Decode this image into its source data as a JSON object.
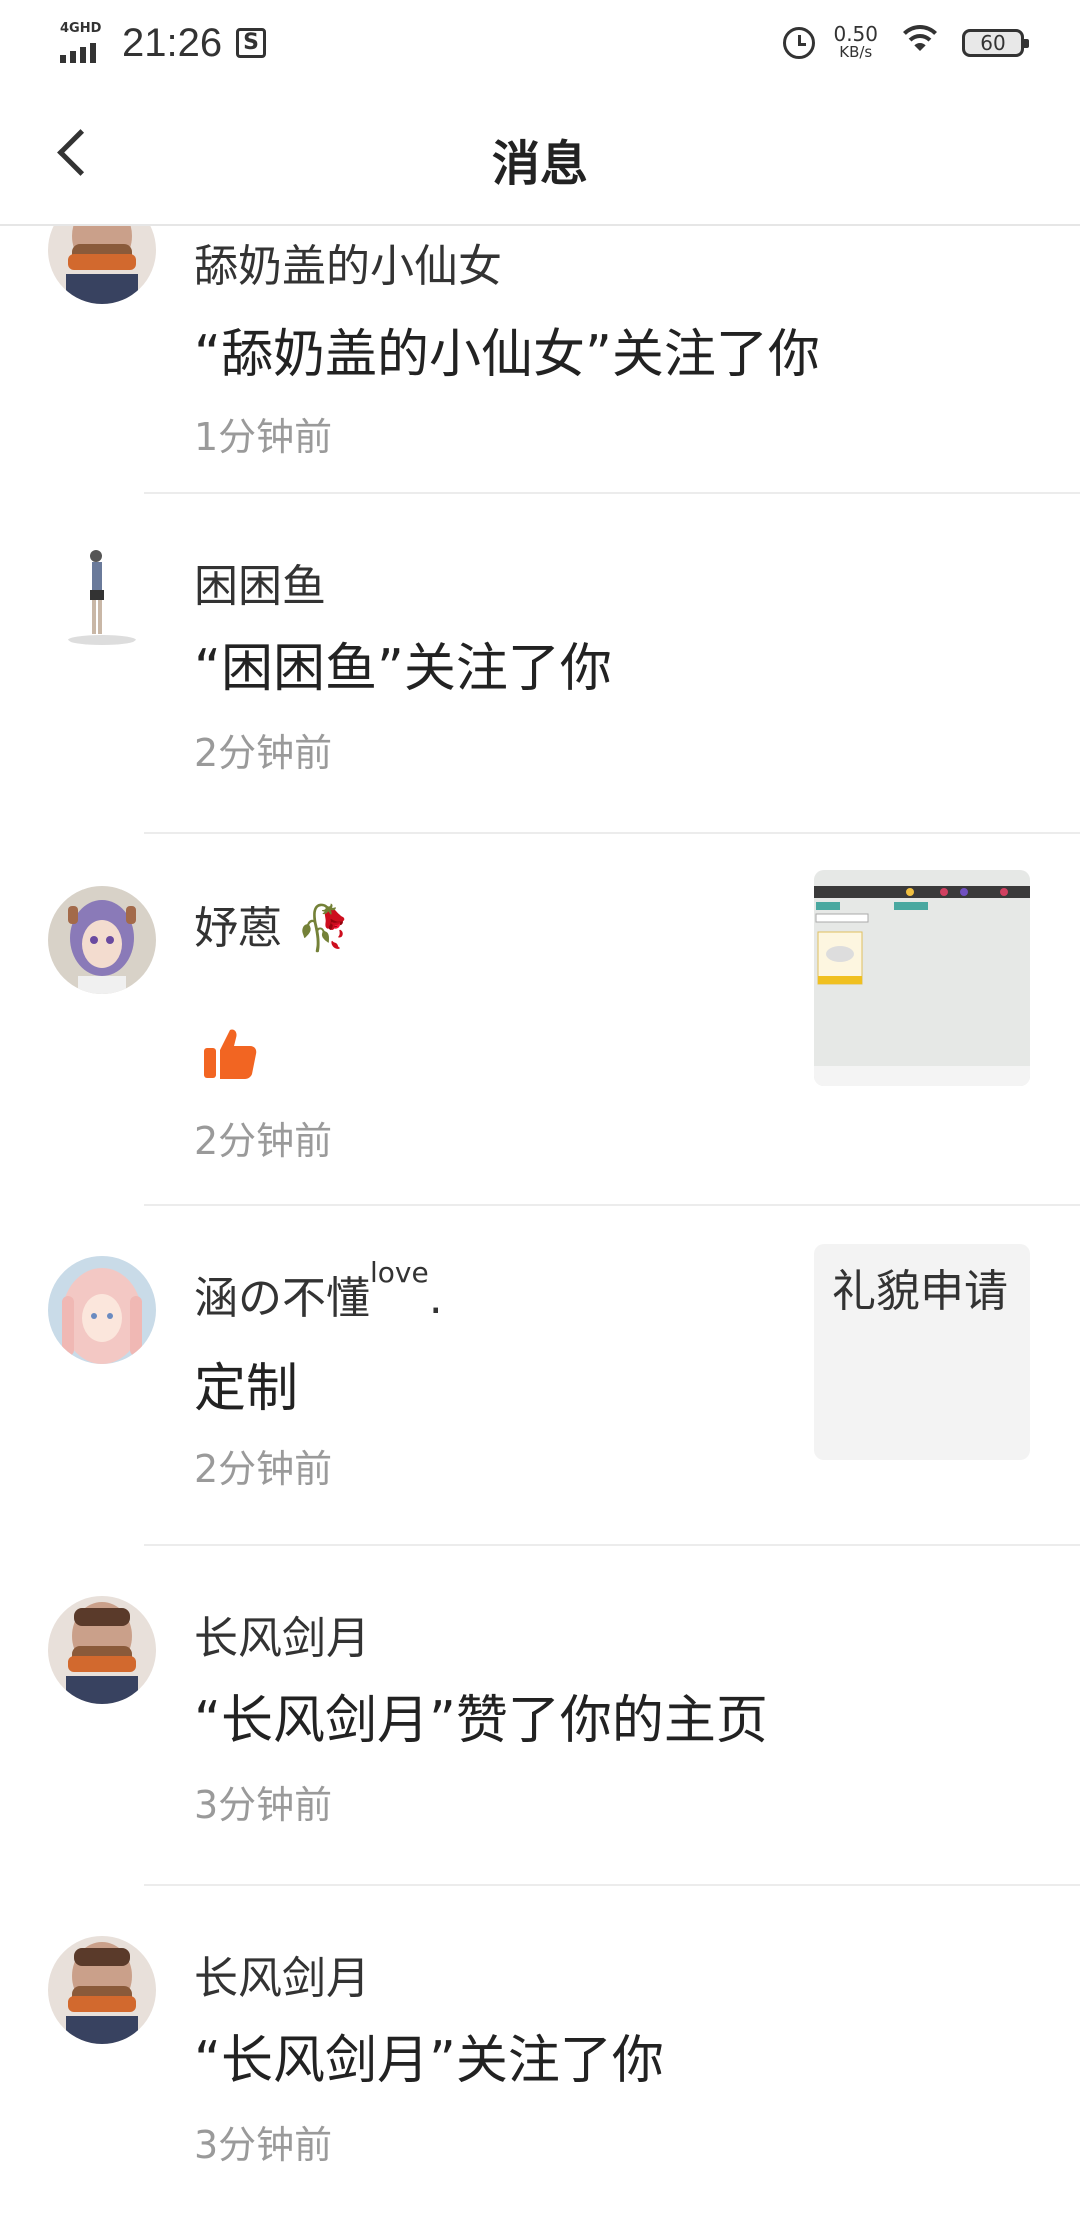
{
  "status_bar": {
    "network": "4GHD",
    "time": "21:26",
    "speed_value": "0.50",
    "speed_unit": "KB/s",
    "battery": "60"
  },
  "header": {
    "back_icon": "chevron-left-icon",
    "title": "消息"
  },
  "messages": [
    {
      "name": "舔奶盖的小仙女",
      "text": "“舔奶盖的小仙女”关注了你",
      "time": "1分钟前"
    },
    {
      "name": "困困鱼",
      "text": "“困困鱼”关注了你",
      "time": "2分钟前"
    },
    {
      "name": "妤蒽",
      "name_emoji": "🥀",
      "icon": "thumbs-up-icon",
      "time": "2分钟前"
    },
    {
      "name": "涵の不懂",
      "name_sup": "love",
      "name_suffix": ".",
      "text": "定制",
      "thumb_text": "礼貌申请",
      "time": "2分钟前"
    },
    {
      "name": "长风剑月",
      "text": "“长风剑月”赞了你的主页",
      "time": "3分钟前"
    },
    {
      "name": "长风剑月",
      "text": "“长风剑月”关注了你",
      "time": "3分钟前"
    }
  ],
  "colors": {
    "like_orange": "#f26522",
    "divider": "#ececec",
    "time_gray": "#9a9a9a"
  }
}
